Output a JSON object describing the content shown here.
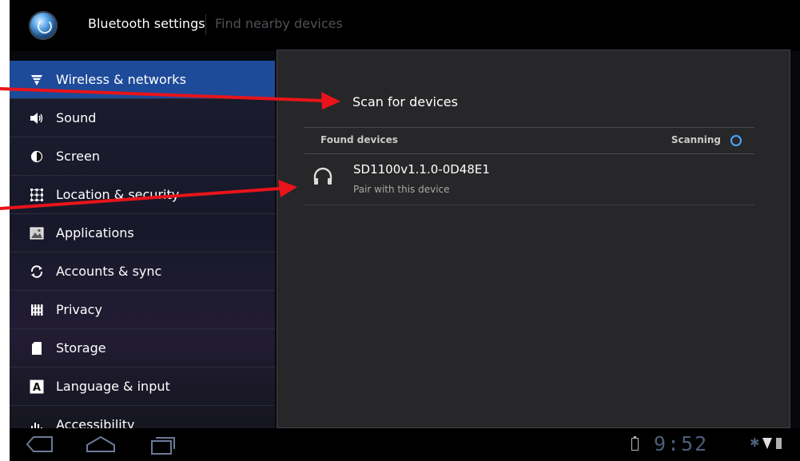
{
  "action_bar": {
    "title": "Bluetooth settings",
    "subtab": "Find nearby devices",
    "app_icon": "settings-app-icon"
  },
  "sidebar": {
    "items": [
      {
        "label": "Wireless & networks",
        "icon": "wifi-icon",
        "selected": true
      },
      {
        "label": "Sound",
        "icon": "speaker-icon"
      },
      {
        "label": "Screen",
        "icon": "brightness-icon"
      },
      {
        "label": "Location & security",
        "icon": "location-grid-icon"
      },
      {
        "label": "Applications",
        "icon": "applications-icon"
      },
      {
        "label": "Accounts & sync",
        "icon": "sync-icon"
      },
      {
        "label": "Privacy",
        "icon": "privacy-icon"
      },
      {
        "label": "Storage",
        "icon": "sd-card-icon"
      },
      {
        "label": "Language & input",
        "icon": "keyboard-a-icon"
      },
      {
        "label": "Accessibility",
        "icon": "accessibility-icon"
      }
    ]
  },
  "main": {
    "scan_label": "Scan for devices",
    "found_header": "Found devices",
    "scanning_label": "Scanning",
    "devices": [
      {
        "name": "SD1100v1.1.0-0D48E1",
        "subtitle": "Pair with this device",
        "icon": "headphones-icon"
      }
    ]
  },
  "system_bar": {
    "clock": "9:52",
    "accent_color": "#4c5c78"
  },
  "colors": {
    "selected_item": "#1e4a9a",
    "annotation_arrow": "#e8141a"
  }
}
